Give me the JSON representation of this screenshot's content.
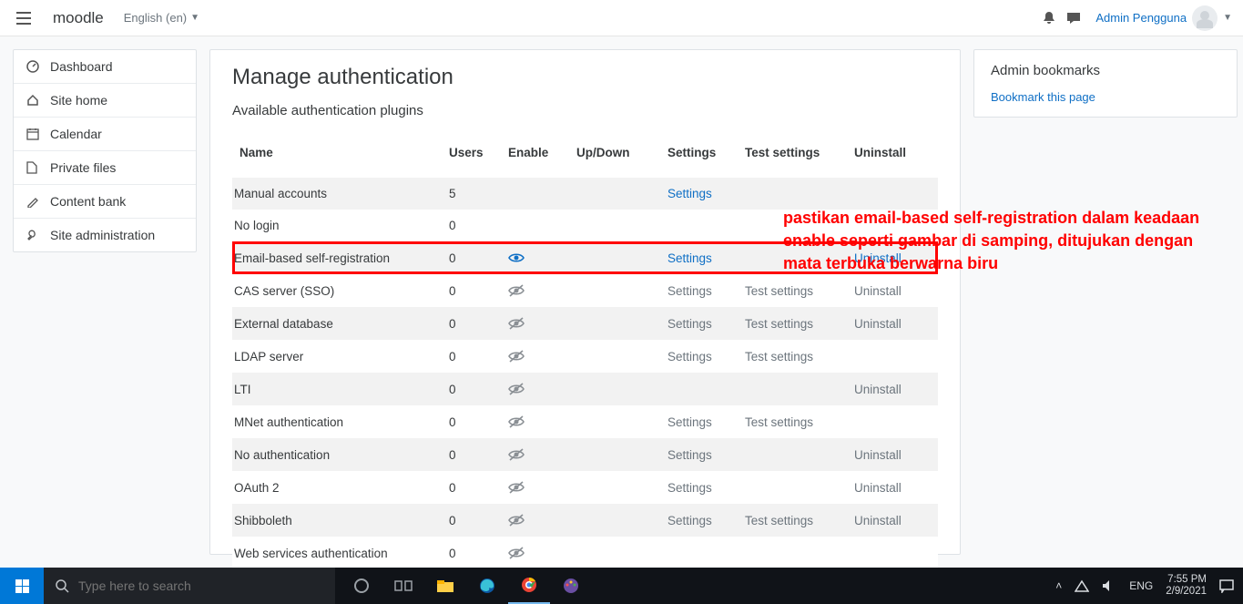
{
  "header": {
    "brand": "moodle",
    "language": "English (en)",
    "user_name": "Admin Pengguna"
  },
  "sidebar": {
    "items": [
      {
        "icon": "dashboard-icon",
        "label": "Dashboard"
      },
      {
        "icon": "home-icon",
        "label": "Site home"
      },
      {
        "icon": "calendar-icon",
        "label": "Calendar"
      },
      {
        "icon": "file-icon",
        "label": "Private files"
      },
      {
        "icon": "paint-icon",
        "label": "Content bank"
      },
      {
        "icon": "wrench-icon",
        "label": "Site administration"
      }
    ]
  },
  "main": {
    "title": "Manage authentication",
    "subtitle": "Available authentication plugins",
    "columns": {
      "name": "Name",
      "users": "Users",
      "enable": "Enable",
      "updown": "Up/Down",
      "settings": "Settings",
      "test": "Test settings",
      "uninstall": "Uninstall"
    },
    "rows": [
      {
        "name": "Manual accounts",
        "users": "5",
        "enable": "",
        "settings": "Settings",
        "settings_link": true,
        "test": "",
        "uninstall": "",
        "highlight": false
      },
      {
        "name": "No login",
        "users": "0",
        "enable": "",
        "settings": "",
        "settings_link": false,
        "test": "",
        "uninstall": "",
        "highlight": false
      },
      {
        "name": "Email-based self-registration",
        "users": "0",
        "enable": "enabled",
        "settings": "Settings",
        "settings_link": true,
        "test": "",
        "uninstall": "Uninstall",
        "uninstall_link": true,
        "highlight": true
      },
      {
        "name": "CAS server (SSO)",
        "users": "0",
        "enable": "disabled",
        "settings": "Settings",
        "settings_link": false,
        "test": "Test settings",
        "uninstall": "Uninstall",
        "highlight": false
      },
      {
        "name": "External database",
        "users": "0",
        "enable": "disabled",
        "settings": "Settings",
        "settings_link": false,
        "test": "Test settings",
        "uninstall": "Uninstall",
        "highlight": false
      },
      {
        "name": "LDAP server",
        "users": "0",
        "enable": "disabled",
        "settings": "Settings",
        "settings_link": false,
        "test": "Test settings",
        "uninstall": "",
        "highlight": false
      },
      {
        "name": "LTI",
        "users": "0",
        "enable": "disabled",
        "settings": "",
        "settings_link": false,
        "test": "",
        "uninstall": "Uninstall",
        "highlight": false
      },
      {
        "name": "MNet authentication",
        "users": "0",
        "enable": "disabled",
        "settings": "Settings",
        "settings_link": false,
        "test": "Test settings",
        "uninstall": "",
        "highlight": false
      },
      {
        "name": "No authentication",
        "users": "0",
        "enable": "disabled",
        "settings": "Settings",
        "settings_link": false,
        "test": "",
        "uninstall": "Uninstall",
        "highlight": false
      },
      {
        "name": "OAuth 2",
        "users": "0",
        "enable": "disabled",
        "settings": "Settings",
        "settings_link": false,
        "test": "",
        "uninstall": "Uninstall",
        "highlight": false
      },
      {
        "name": "Shibboleth",
        "users": "0",
        "enable": "disabled",
        "settings": "Settings",
        "settings_link": false,
        "test": "Test settings",
        "uninstall": "Uninstall",
        "highlight": false
      },
      {
        "name": "Web services authentication",
        "users": "0",
        "enable": "disabled",
        "settings": "",
        "settings_link": false,
        "test": "",
        "uninstall": "",
        "highlight": false
      }
    ]
  },
  "aside": {
    "title": "Admin bookmarks",
    "link": "Bookmark this page"
  },
  "annotation": "pastikan email-based self-registration dalam keadaan enable seperti gambar di samping, ditujukan dengan mata terbuka berwarna biru",
  "taskbar": {
    "search_placeholder": "Type here to search",
    "lang": "ENG",
    "time": "7:55 PM",
    "date": "2/9/2021"
  }
}
